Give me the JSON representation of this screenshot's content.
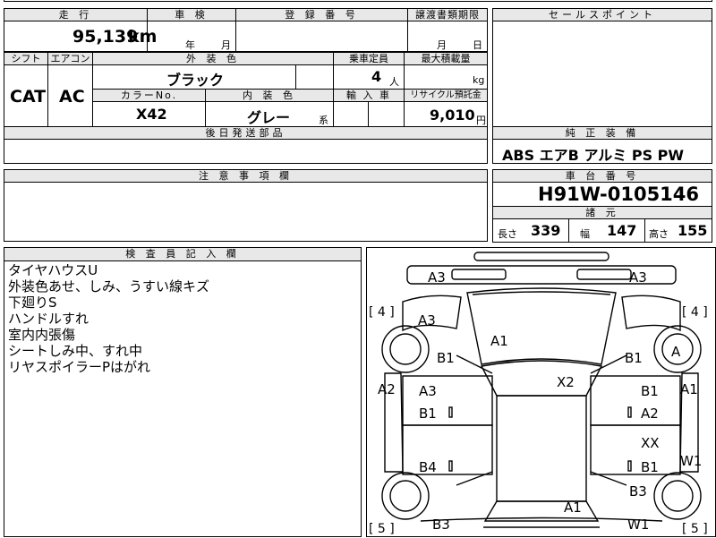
{
  "header": {
    "distance_label": "走 行",
    "inspection_label": "車 検",
    "registration_label": "登 録 番 号",
    "transfer_label": "譲渡書類期限",
    "sales_point_label": "セールスポイント"
  },
  "mileage": {
    "value": "95,139",
    "unit": "km"
  },
  "inspection_date": {
    "year_label": "年",
    "month_label": "月"
  },
  "transfer_date": {
    "month_label": "月",
    "day_label": "日"
  },
  "row2": {
    "shift_label": "シフト",
    "aircon_label": "エアコン",
    "exterior_label": "外 装 色",
    "capacity_label": "乗車定員",
    "max_load_label": "最大積載量",
    "shift_value": "CAT",
    "aircon_value": "AC",
    "exterior_value": "ブラック",
    "capacity_value": "4",
    "capacity_unit": "人",
    "max_load_unit": "kg",
    "color_no_label": "カラーNo.",
    "interior_label": "内 装 色",
    "import_label": "輸 入 車",
    "recycle_label": "リサイクル預託金",
    "color_no_value": "X42",
    "interior_value": "グレー",
    "interior_suffix": "系",
    "recycle_value": "9,010",
    "recycle_unit": "円"
  },
  "later_parts_label": "後日発送部品",
  "equipment": {
    "label": "純 正 装 備",
    "value": "ABS エアB アルミ PS PW"
  },
  "notes_label": "注 意 事 項 欄",
  "chassis": {
    "label": "車 台 番 号",
    "value": "H91W-0105146",
    "spec_label": "諸 元"
  },
  "dimensions": {
    "length_label": "長さ",
    "length_value": "339",
    "width_label": "幅",
    "width_value": "147",
    "height_label": "高さ",
    "height_value": "155"
  },
  "inspector": {
    "label": "検 査 員 記 入 欄",
    "lines": [
      "タイヤハウスU",
      "外装色あせ、しみ、うすい線キズ",
      "下廻りS",
      "ハンドルすれ",
      "室内内張傷",
      "シートしみ中、すれ中",
      "リヤスポイラーPはがれ"
    ]
  },
  "diagram": {
    "tire_front_left": "[ 4 ]",
    "tire_front_right": "[ 4 ]",
    "tire_rear_left": "[ 5 ]",
    "tire_rear_right": "[ 5 ]",
    "marks": [
      "A3",
      "A3",
      "A3",
      "A1",
      "B1",
      "B1",
      "A",
      "A2",
      "A1",
      "X2",
      "A3",
      "B1",
      "B1",
      "A2",
      "XX",
      "B4",
      "B1",
      "W1",
      "B3",
      "A1",
      "B3",
      "W1"
    ]
  }
}
